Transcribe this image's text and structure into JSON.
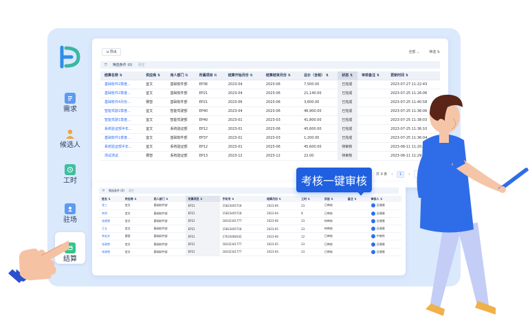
{
  "nav": [
    {
      "label": "需求",
      "icon": "document-icon",
      "active": false
    },
    {
      "label": "候选人",
      "icon": "candidate-icon",
      "active": false
    },
    {
      "label": "工时",
      "icon": "timesheet-icon",
      "active": false
    },
    {
      "label": "驻场",
      "icon": "onsite-icon",
      "active": false
    },
    {
      "label": "结算",
      "icon": "settlement-icon",
      "active": true
    }
  ],
  "toolbar": {
    "export_label": "导出",
    "right_1": "全部 ⌄",
    "right_2": "筛选 ⇅"
  },
  "filter": {
    "label": "筛选条件 (0)",
    "clear": "清空"
  },
  "table": {
    "headers": [
      "结算名称 ⇅",
      "供应商 ⇅",
      "用人部门 ⇅",
      "所属项目 ⇅",
      "结算开始月份 ⇅",
      "结算结束月份 ⇅",
      "总价（含税） ⇅",
      "状态 ⇅",
      "审核备注 ⇅",
      "更新时间 ⇅"
    ],
    "rows": [
      [
        "基础软件2季度...",
        "宜文",
        "基础软件部",
        "EP36",
        "2023-04",
        "2023-06",
        "7,500.00",
        "已完成",
        "",
        "2023-07-27 11:22:43"
      ],
      [
        "基础软件2季度...",
        "宜文",
        "基础软件部",
        "EP21",
        "2023-04",
        "2023-06",
        "21,140.00",
        "已完成",
        "",
        "2023-07-25 11:26:06"
      ],
      [
        "基础软件4月份...",
        "赛智",
        "基础软件部",
        "EP21",
        "2023-06",
        "2023-06",
        "3,600.00",
        "已完成",
        "",
        "2023-07-25 11:40:58"
      ],
      [
        "智能驾驶2季度...",
        "宜文",
        "智能驾驶部",
        "EP40",
        "2023-04",
        "2023-06",
        "46,900.00",
        "已完成",
        "",
        "2023-07-25 11:36:06"
      ],
      [
        "智能驾驶1季度...",
        "宜文",
        "智能驾驶部",
        "EP40",
        "2023-01",
        "2023-03",
        "41,800.00",
        "已完成",
        "",
        "2023-07-25 11:38:03"
      ],
      [
        "系统验证部半年...",
        "宜文",
        "系统验证部",
        "EP12",
        "2023-01",
        "2023-06",
        "45,600.00",
        "已完成",
        "",
        "2023-07-25 11:36:10"
      ],
      [
        "基础软件1季度...",
        "宜文",
        "基础软件部",
        "EP37",
        "2023-01",
        "2023-03",
        "1,200.00",
        "已完成",
        "",
        "2023-07-25 11:36:04"
      ],
      [
        "系统验证部半年...",
        "宜文",
        "系统验证部",
        "EP12",
        "2023-01",
        "2023-06",
        "45,600.00",
        "待审核",
        "",
        "2023-06-11 11:20:28"
      ],
      [
        "测试测试",
        "赛智",
        "系统验证部",
        "EP13",
        "2023-12",
        "2023-12",
        "22.00",
        "待审核",
        "",
        "2023-06-11 11:29:53"
      ]
    ]
  },
  "pager": {
    "total": "共 9 条",
    "prev": "‹",
    "page": "1",
    "next": "›",
    "size": "10 条/页"
  },
  "tooltip": {
    "label": "考核一键审核"
  },
  "sub": {
    "filter_label": "筛选条件 (0)",
    "filter_clear": "清空",
    "headers": [
      "姓名 ⇅",
      "供应商 ⇅",
      "用人部门 ⇅",
      "所属项目 ⇅",
      "手机号 ⇅",
      "结算月份 ⇅",
      "工时 ⇅",
      "状态 ⇅",
      "备注 ⇅",
      "审核人 ⇅"
    ],
    "rows": [
      [
        "张三",
        "宜文",
        "基础软件部",
        "EP21",
        "15823405718",
        "2023-06",
        "23",
        "已审核",
        "",
        "吕湘湘"
      ],
      [
        "李四",
        "宜文",
        "基础软件部",
        "EP21",
        "15823405718",
        "2023-04",
        "8",
        "已审核",
        "",
        "吕湘湘"
      ],
      [
        "张政港",
        "宜文",
        "基础软件部",
        "EP21",
        "18102341777",
        "2023-06",
        "23",
        "待审核",
        "",
        "吕湘湘"
      ],
      [
        "王五",
        "宜文",
        "基础软件部",
        "EP21",
        "15823405718",
        "2023-05",
        "23",
        "待审核",
        "",
        "吕湘湘"
      ],
      [
        "李宏文",
        "赛智",
        "基础软件部",
        "EP21",
        "17633468342",
        "2023-06",
        "12",
        "已审核",
        "",
        "牛晓明"
      ],
      [
        "张政港",
        "宜文",
        "基础软件部",
        "EP21",
        "18102341777",
        "2023-05",
        "23",
        "已审核",
        "",
        "吕湘湘"
      ],
      [
        "张政港",
        "宜文",
        "基础软件部",
        "EP21",
        "18102341777",
        "2023-04",
        "23",
        "已审核",
        "",
        "吕湘湘"
      ]
    ]
  },
  "colors": {
    "accent": "#1f5fe0",
    "link": "#2b6ef3",
    "panel": "#dbe9fd"
  }
}
